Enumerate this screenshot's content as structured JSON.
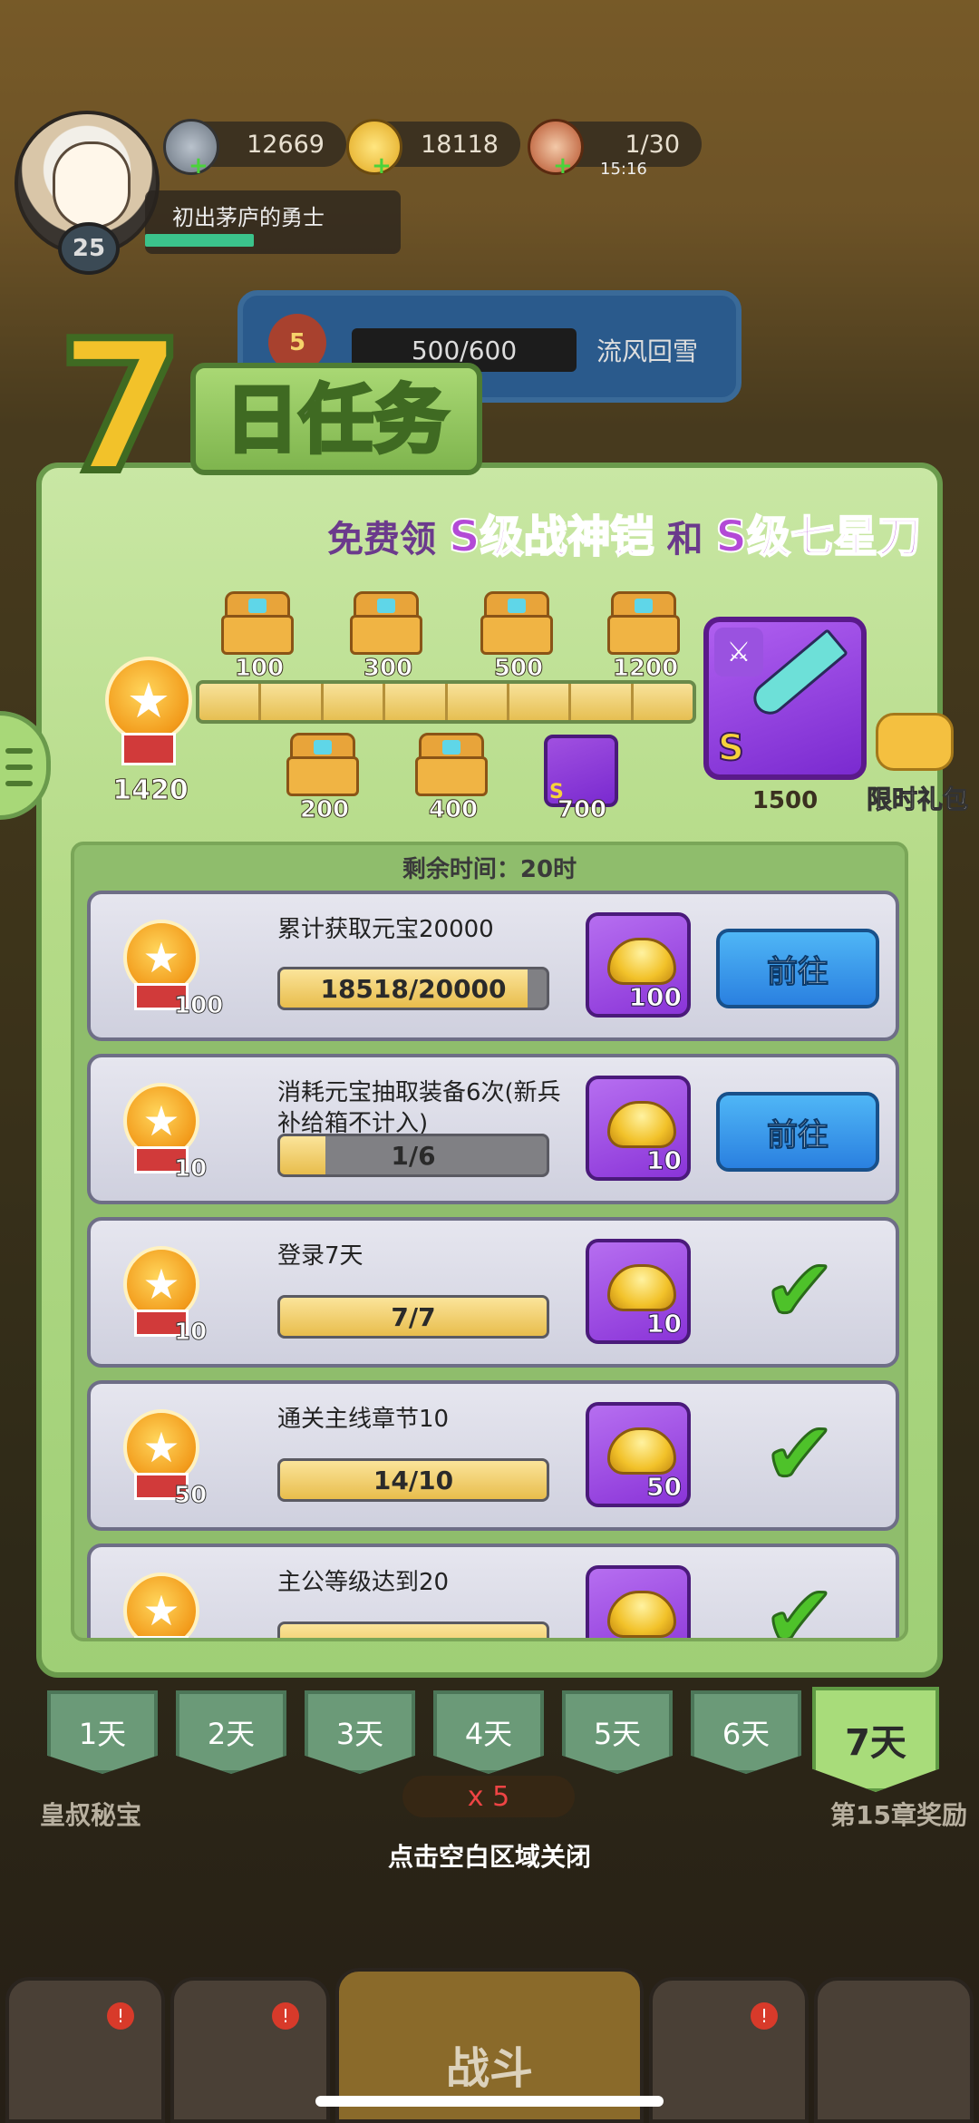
{
  "top": {
    "silver": "12669",
    "ingots": "18118",
    "stamina": "1/30",
    "stamina_timer": "15:16",
    "player_title": "初出茅庐的勇士",
    "level": "25"
  },
  "stage": {
    "rank": "5",
    "progress": "500/600",
    "name": "流风回雪"
  },
  "panel": {
    "title_number": "7",
    "title_text": "日任务",
    "subtitle_prefix": "免费领",
    "subtitle_item1": "S级战神铠",
    "subtitle_mid": "和",
    "subtitle_item2": "S级七星刀",
    "current_points": "1420",
    "milestones_top": [
      "100",
      "300",
      "500",
      "1200"
    ],
    "milestones_bottom": [
      "200",
      "400",
      "700"
    ],
    "final_milestone": "1500",
    "grade_letter": "S",
    "gift_label": "限时礼包",
    "remaining_time": "剩余时间：20时"
  },
  "tasks": [
    {
      "title": "累计获取元宝20000",
      "progress": "18518/20000",
      "fill": 0.93,
      "points": "100",
      "reward": "100",
      "state": "go"
    },
    {
      "title": "消耗元宝抽取装备6次(新兵补给箱不计入)",
      "progress": "1/6",
      "fill": 0.17,
      "points": "10",
      "reward": "10",
      "state": "go"
    },
    {
      "title": "登录7天",
      "progress": "7/7",
      "fill": 1.0,
      "points": "10",
      "reward": "10",
      "state": "done"
    },
    {
      "title": "通关主线章节10",
      "progress": "14/10",
      "fill": 1.0,
      "points": "50",
      "reward": "50",
      "state": "done"
    },
    {
      "title": "主公等级达到20",
      "progress": "",
      "fill": 1.0,
      "points": "",
      "reward": "",
      "state": "done"
    }
  ],
  "go_label": "前往",
  "days": [
    "1天",
    "2天",
    "3天",
    "4天",
    "5天",
    "6天",
    "7天"
  ],
  "active_day": 6,
  "bottom": {
    "left_label": "皇叔秘宝",
    "right_label": "第15章奖励",
    "multiplier": "x 5",
    "close_hint": "点击空白区域关闭",
    "battle_label": "战斗",
    "badge": "!"
  },
  "colors": {
    "panel_green": "#b5db88",
    "go_blue": "#2a80e0",
    "reward_purple": "#8a34d8",
    "check_green": "#4ec22a",
    "highlight_purple": "#b34ad6"
  }
}
